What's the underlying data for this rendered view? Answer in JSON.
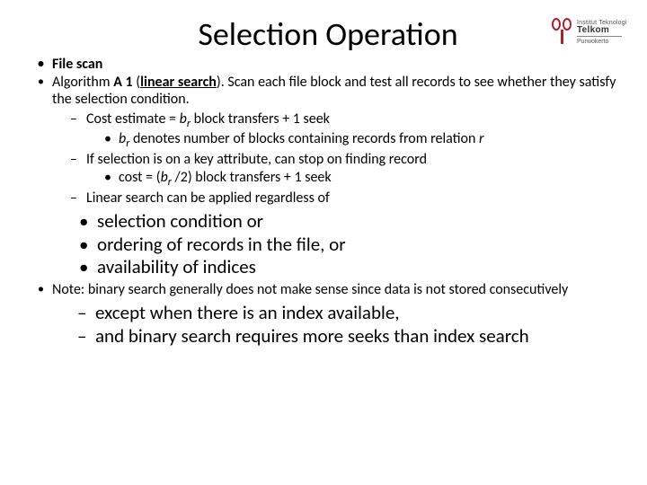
{
  "logo": {
    "line1": "Institut Teknologi",
    "line2": "Telkom",
    "line3": "Purwokerto"
  },
  "title": "Selection Operation",
  "b1": "File scan",
  "b2_pre": "Algorithm",
  "b2_alg": "A 1",
  "b2_paren_open": " (",
  "b2_search": "linear search",
  "b2_paren_close": ").",
  "b2_rest": "  Scan each file block and test all records to see whether they satisfy the selection condition.",
  "b2a_pre": "Cost estimate = ",
  "b2a_var": "b",
  "b2a_sub": "r",
  "b2a_rest": " block transfers + 1 seek",
  "b2a1_var": "b",
  "b2a1_sub": "r",
  "b2a1_mid": "  denotes number of blocks containing records from relation ",
  "b2a1_r": "r",
  "b2b": "If selection is on a key attribute, can stop on finding record",
  "b2b1_pre": "cost = (",
  "b2b1_var": "b",
  "b2b1_sub": "r",
  "b2b1_rest": " /2) block transfers + 1 seek",
  "b2c": "Linear search can be applied regardless of",
  "big1": "selection condition or",
  "big2": "ordering of records in the file, or",
  "big3": "availability of indices",
  "b3": "Note: binary search generally does not make sense since data is not stored consecutively",
  "bd1": "except when there is an index available,",
  "bd2": "and binary search requires more seeks than index search"
}
